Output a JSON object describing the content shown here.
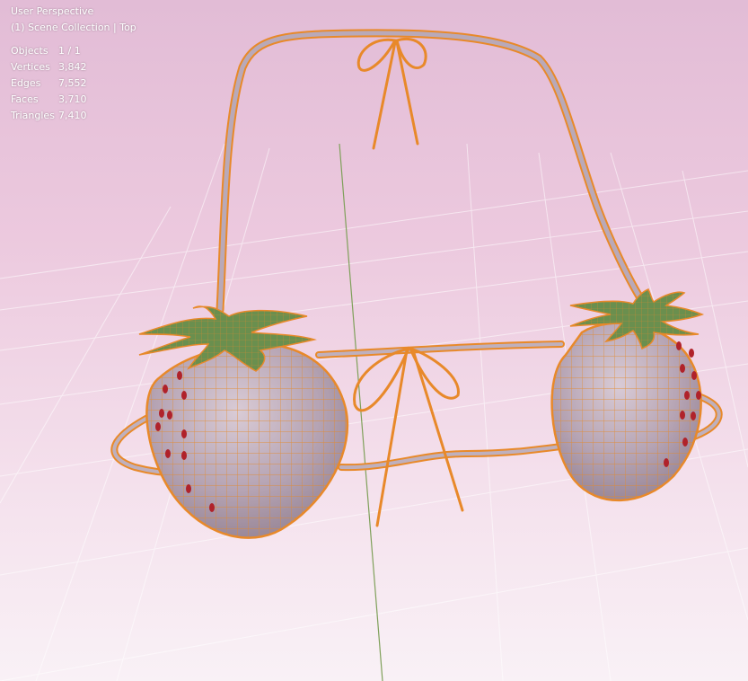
{
  "viewport": {
    "view_name": "User Perspective",
    "collection_path": "(1) Scene Collection | Top",
    "background_top": "#e2bcd6",
    "background_bottom": "#f9f1f6",
    "selection_outline_color": "#e8892a",
    "wireframe_color": "#e38a2c",
    "mesh_color": "#b7a6b4"
  },
  "statistics": [
    {
      "label": "Objects",
      "value": "1 / 1"
    },
    {
      "label": "Vertices",
      "value": "3,842"
    },
    {
      "label": "Edges",
      "value": "7,552"
    },
    {
      "label": "Faces",
      "value": "3,710"
    },
    {
      "label": "Triangles",
      "value": "7,410"
    }
  ],
  "object": {
    "kind": "strawberry-bikini-top-mesh",
    "state": "selected-wireframe-overlay"
  }
}
